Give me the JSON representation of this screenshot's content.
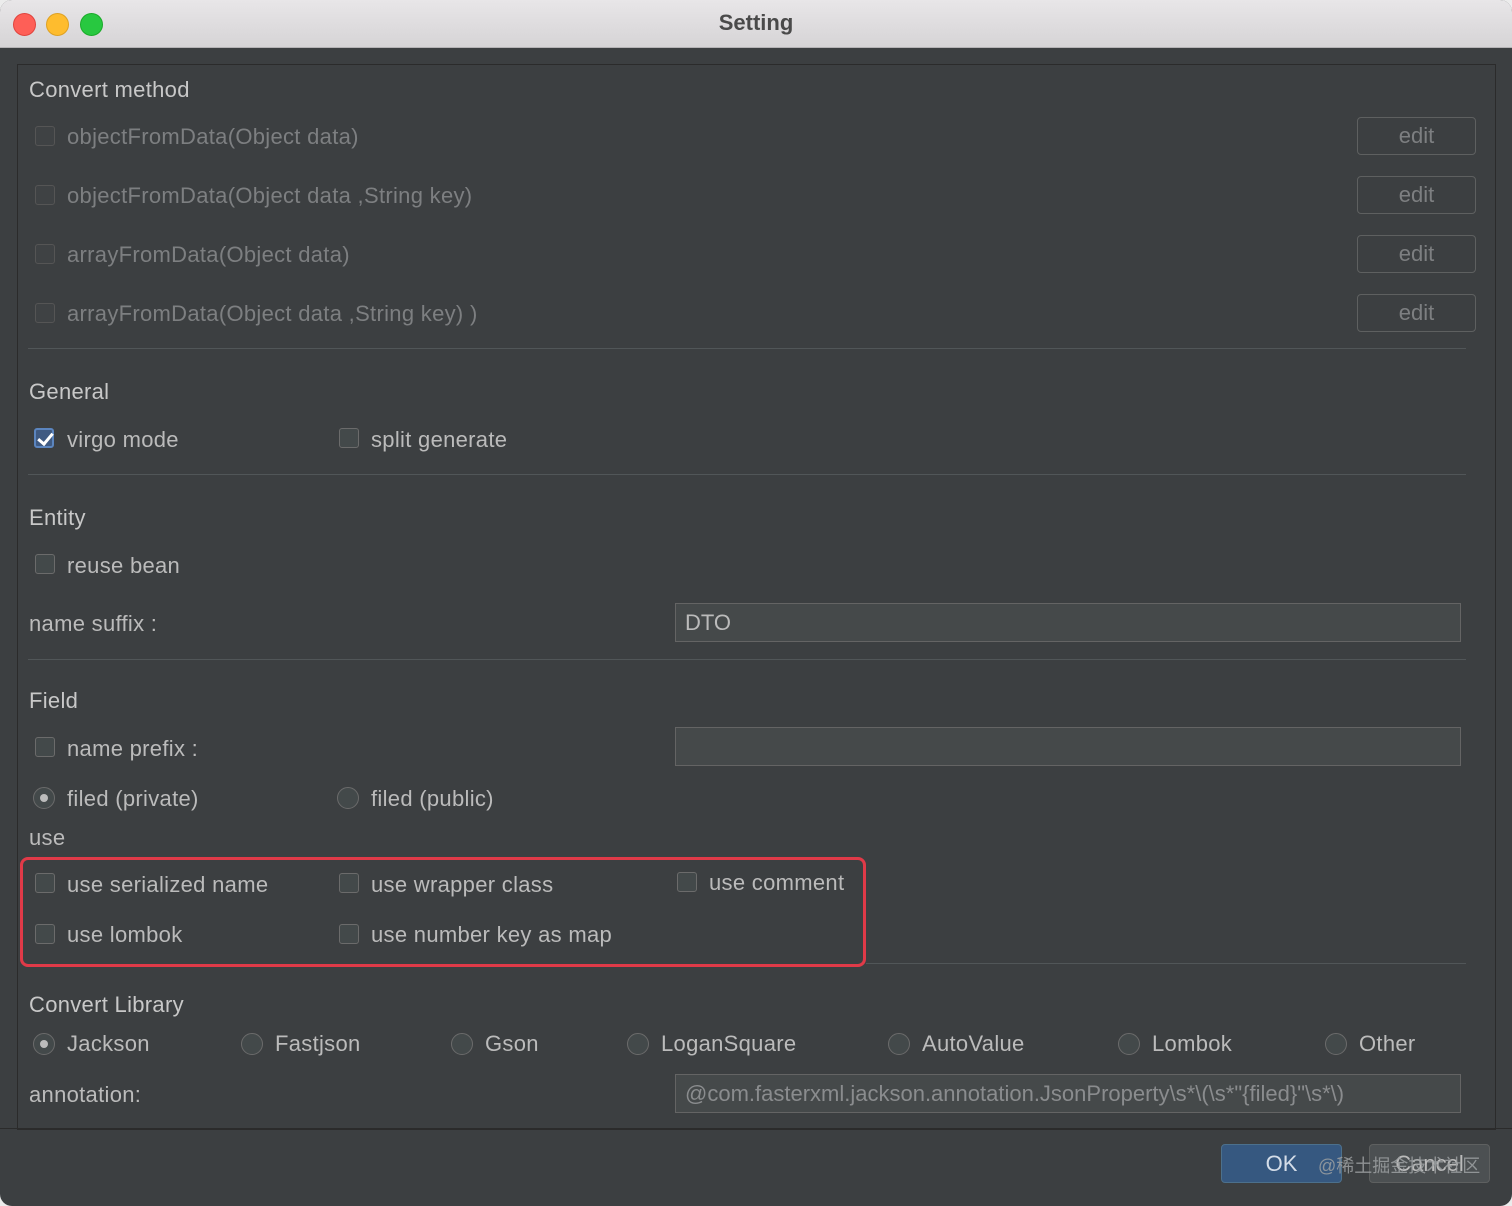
{
  "window": {
    "title": "Setting"
  },
  "convert_method": {
    "heading": "Convert method",
    "items": [
      {
        "label": "objectFromData(Object data)",
        "checked": false,
        "button": "edit"
      },
      {
        "label": "objectFromData(Object data ,String key)",
        "checked": false,
        "button": "edit"
      },
      {
        "label": "arrayFromData(Object data)",
        "checked": false,
        "button": "edit"
      },
      {
        "label": "arrayFromData(Object data ,String key) )",
        "checked": false,
        "button": "edit"
      }
    ]
  },
  "general": {
    "heading": "General",
    "virgo_mode": {
      "label": "virgo mode",
      "checked": true
    },
    "split_generate": {
      "label": "split generate",
      "checked": false
    }
  },
  "entity": {
    "heading": "Entity",
    "reuse_bean": {
      "label": "reuse bean",
      "checked": false
    },
    "name_suffix": {
      "label": "name suffix :",
      "value": "DTO"
    }
  },
  "field": {
    "heading": "Field",
    "name_prefix": {
      "label": "name prefix :",
      "checked": false,
      "value": ""
    },
    "filed_private": {
      "label": "filed (private)",
      "selected": true
    },
    "filed_public": {
      "label": "filed (public)",
      "selected": false
    },
    "use_heading": "use",
    "use_serialized_name": {
      "label": "use serialized name",
      "checked": false
    },
    "use_wrapper_class": {
      "label": "use wrapper class",
      "checked": false
    },
    "use_comment": {
      "label": "use comment",
      "checked": false
    },
    "use_lombok": {
      "label": "use lombok",
      "checked": false
    },
    "use_number_key_as_map": {
      "label": "use number key as map",
      "checked": false
    }
  },
  "convert_library": {
    "heading": "Convert Library",
    "options": [
      "Jackson",
      "Fastjson",
      "Gson",
      "LoganSquare",
      "AutoValue",
      "Lombok",
      "Other"
    ],
    "selected": "Jackson",
    "annotation_label": "annotation:",
    "annotation_value": "@com.fasterxml.jackson.annotation.JsonProperty\\s*\\(\\s*\"{filed}\"\\s*\\)"
  },
  "footer": {
    "ok": "OK",
    "cancel": "Cancel",
    "watermark": "@稀土掘金技术社区"
  },
  "colors": {
    "background": "#3c3f41",
    "highlight_border": "#e03a48",
    "ok_button": "#365880",
    "checkbox_checked": "#3f5a82"
  }
}
